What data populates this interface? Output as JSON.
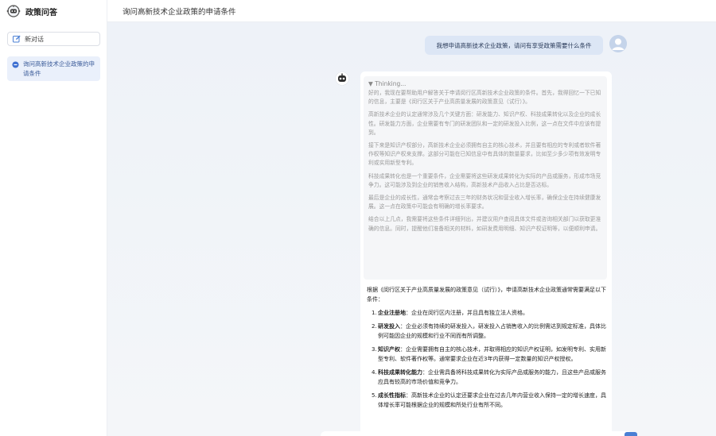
{
  "app": {
    "name": "政策问答"
  },
  "sidebar": {
    "new_chat_label": "新对话",
    "conversations": [
      {
        "label": "询问高新技术企业政策的申请条件"
      }
    ]
  },
  "header": {
    "title": "询问高新技术企业政策的申请条件"
  },
  "chat": {
    "user_message": "我想申请高新技术企业政策，请问有享受政策需要什么条件",
    "thinking": {
      "label": "▼ Thinking...",
      "paragraphs": [
        "好的，我现在要帮助用户解答关于申请闵行区高新技术企业政策的条件。首先，我得回忆一下已知的信息，主要是《闵行区关于产业高质量发展的政策意见（试行）》。",
        "高新技术企业的认定通常涉及几个关键方面：研发能力、知识产权、科技成果转化以及企业的成长性。研发能力方面，企业需要有专门的研发团队和一定的研发投入比例，这一点在文件中应该有提到。",
        "接下来是知识产权部分，高新技术企业必须拥有自主的核心技术，并且要有相应的专利或者软件著作权等知识产权来支撑。这部分可能在已知信息中有具体的数量要求，比如至少多少项有效发明专利或实用新型专利。",
        "科技成果转化也是一个重要条件，企业需要将这些研发成果转化为实际的产品或服务，形成市场竞争力。这可能涉及到企业的销售收入结构，高新技术产品收入占比是否达标。",
        "最后是企业的成长性，通常会考察过去三年的财务状况和营业收入增长率，确保企业在持续健康发展。这一点在政策中可能会有明确的增长率要求。",
        "结合以上几点，我需要将这些条件详细列出，并建议用户查阅具体文件或咨询相关部门以获取更准确的信息。同时，提醒他们准备相关的材料，如研发费用明细、知识产权证明等，以便顺利申请。"
      ]
    },
    "answer": {
      "intro": "根据《闵行区关于产业高质量发展的政策意见（试行）》，申请高新技术企业政策通常需要满足以下条件：",
      "items": [
        {
          "num": "1.",
          "title": "企业注册地",
          "text": "：企业在闵行区内注册，并且具有独立法人资格。"
        },
        {
          "num": "2.",
          "title": "研发投入",
          "text": "：企业必须有持续的研发投入，研发投入占销售收入的比例需达到规定标准，具体比例可能因企业的规模和行业不同而有所调整。"
        },
        {
          "num": "3.",
          "title": "知识产权",
          "text": "：企业需要拥有自主的核心技术，并取得相应的知识产权证明，如发明专利、实用新型专利、软件著作权等。通常要求企业在近3年内获得一定数量的知识产权授权。"
        },
        {
          "num": "4.",
          "title": "科技成果转化能力",
          "text": "：企业需具备将科技成果转化为实际产品或服务的能力，且这些产品或服务应具有较高的市场价值和竞争力。"
        },
        {
          "num": "5.",
          "title": "成长性指标",
          "text": "：高新技术企业的认定还要求企业在过去几年内营业收入保持一定的增长速度，具体增长率可能根据企业的规模和所处行业有所不同。"
        }
      ]
    }
  },
  "colors": {
    "accent": "#4a7fd4",
    "user_bubble": "#dce6f5",
    "selected_item": "#eaf0fb"
  }
}
